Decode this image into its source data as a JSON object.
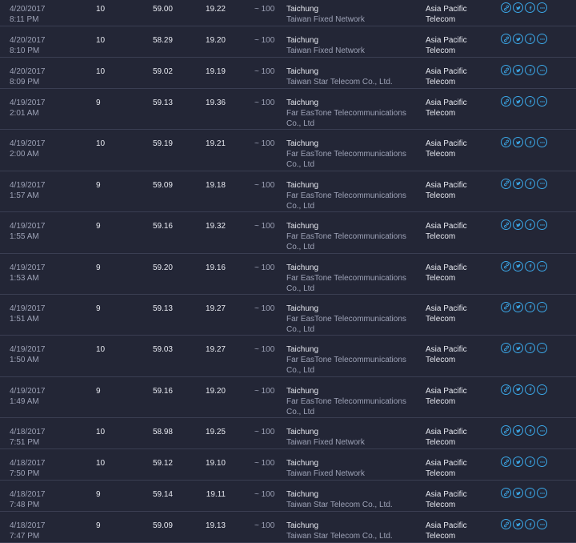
{
  "icons": [
    "link-icon",
    "twitter-icon",
    "facebook-icon",
    "more-icon"
  ],
  "accent": "#3ba8e8",
  "rows": [
    {
      "date": "4/20/2017",
      "time": "8:11 PM",
      "dl": "10",
      "ul": "59.00",
      "ping": "19.22",
      "server": "~ 100",
      "city": "Taichung",
      "isp": "Taiwan Fixed Network",
      "prov1": "Asia Pacific",
      "prov2": "Telecom"
    },
    {
      "date": "4/20/2017",
      "time": "8:10 PM",
      "dl": "10",
      "ul": "58.29",
      "ping": "19.20",
      "server": "~ 100",
      "city": "Taichung",
      "isp": "Taiwan Fixed Network",
      "prov1": "Asia Pacific",
      "prov2": "Telecom"
    },
    {
      "date": "4/20/2017",
      "time": "8:09 PM",
      "dl": "10",
      "ul": "59.02",
      "ping": "19.19",
      "server": "~ 100",
      "city": "Taichung",
      "isp": "Taiwan Star Telecom Co., Ltd.",
      "prov1": "Asia Pacific",
      "prov2": "Telecom"
    },
    {
      "date": "4/19/2017",
      "time": "2:01 AM",
      "dl": "9",
      "ul": "59.13",
      "ping": "19.36",
      "server": "~ 100",
      "city": "Taichung",
      "isp": "Far EasTone Telecommunications Co., Ltd",
      "prov1": "Asia Pacific",
      "prov2": "Telecom"
    },
    {
      "date": "4/19/2017",
      "time": "2:00 AM",
      "dl": "10",
      "ul": "59.19",
      "ping": "19.21",
      "server": "~ 100",
      "city": "Taichung",
      "isp": "Far EasTone Telecommunications Co., Ltd",
      "prov1": "Asia Pacific",
      "prov2": "Telecom"
    },
    {
      "date": "4/19/2017",
      "time": "1:57 AM",
      "dl": "9",
      "ul": "59.09",
      "ping": "19.18",
      "server": "~ 100",
      "city": "Taichung",
      "isp": "Far EasTone Telecommunications Co., Ltd",
      "prov1": "Asia Pacific",
      "prov2": "Telecom"
    },
    {
      "date": "4/19/2017",
      "time": "1:55 AM",
      "dl": "9",
      "ul": "59.16",
      "ping": "19.32",
      "server": "~ 100",
      "city": "Taichung",
      "isp": "Far EasTone Telecommunications Co., Ltd",
      "prov1": "Asia Pacific",
      "prov2": "Telecom"
    },
    {
      "date": "4/19/2017",
      "time": "1:53 AM",
      "dl": "9",
      "ul": "59.20",
      "ping": "19.16",
      "server": "~ 100",
      "city": "Taichung",
      "isp": "Far EasTone Telecommunications Co., Ltd",
      "prov1": "Asia Pacific",
      "prov2": "Telecom"
    },
    {
      "date": "4/19/2017",
      "time": "1:51 AM",
      "dl": "9",
      "ul": "59.13",
      "ping": "19.27",
      "server": "~ 100",
      "city": "Taichung",
      "isp": "Far EasTone Telecommunications Co., Ltd",
      "prov1": "Asia Pacific",
      "prov2": "Telecom"
    },
    {
      "date": "4/19/2017",
      "time": "1:50 AM",
      "dl": "10",
      "ul": "59.03",
      "ping": "19.27",
      "server": "~ 100",
      "city": "Taichung",
      "isp": "Far EasTone Telecommunications Co., Ltd",
      "prov1": "Asia Pacific",
      "prov2": "Telecom"
    },
    {
      "date": "4/19/2017",
      "time": "1:49 AM",
      "dl": "9",
      "ul": "59.16",
      "ping": "19.20",
      "server": "~ 100",
      "city": "Taichung",
      "isp": "Far EasTone Telecommunications Co., Ltd",
      "prov1": "Asia Pacific",
      "prov2": "Telecom"
    },
    {
      "date": "4/18/2017",
      "time": "7:51 PM",
      "dl": "10",
      "ul": "58.98",
      "ping": "19.25",
      "server": "~ 100",
      "city": "Taichung",
      "isp": "Taiwan Fixed Network",
      "prov1": "Asia Pacific",
      "prov2": "Telecom"
    },
    {
      "date": "4/18/2017",
      "time": "7:50 PM",
      "dl": "10",
      "ul": "59.12",
      "ping": "19.10",
      "server": "~ 100",
      "city": "Taichung",
      "isp": "Taiwan Fixed Network",
      "prov1": "Asia Pacific",
      "prov2": "Telecom"
    },
    {
      "date": "4/18/2017",
      "time": "7:48 PM",
      "dl": "9",
      "ul": "59.14",
      "ping": "19.11",
      "server": "~ 100",
      "city": "Taichung",
      "isp": "Taiwan Star Telecom Co., Ltd.",
      "prov1": "Asia Pacific",
      "prov2": "Telecom"
    },
    {
      "date": "4/18/2017",
      "time": "7:47 PM",
      "dl": "9",
      "ul": "59.09",
      "ping": "19.13",
      "server": "~ 100",
      "city": "Taichung",
      "isp": "Taiwan Star Telecom Co., Ltd.",
      "prov1": "Asia Pacific",
      "prov2": "Telecom"
    }
  ]
}
